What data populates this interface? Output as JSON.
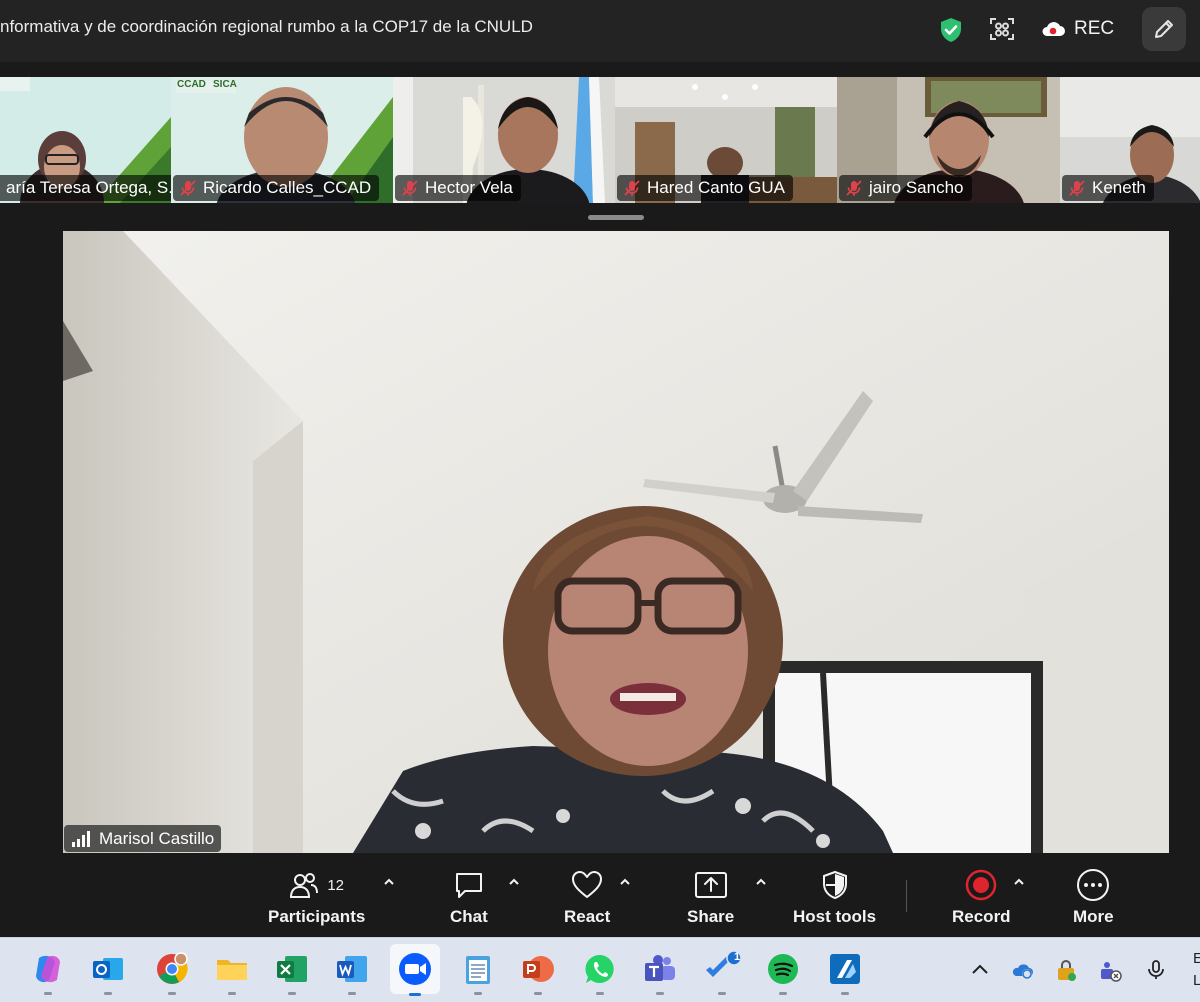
{
  "window": {
    "title": "nformativa y de coordinación regional rumbo a la COP17 de la CNULD",
    "rec_label": "REC"
  },
  "participants": [
    {
      "name": "aría Teresa Ortega, S..."
    },
    {
      "name": "Ricardo Calles_CCAD"
    },
    {
      "name": "Hector Vela"
    },
    {
      "name": "Hared Canto GUA"
    },
    {
      "name": "jairo Sancho"
    },
    {
      "name": "Keneth"
    }
  ],
  "tile_logos": {
    "ccad": "CCAD",
    "sica": "SICA"
  },
  "active_speaker": {
    "name": "Marisol Castillo"
  },
  "toolbar": {
    "participants_label": "Participants",
    "participants_count": "12",
    "chat_label": "Chat",
    "react_label": "React",
    "share_label": "Share",
    "host_tools_label": "Host tools",
    "record_label": "Record",
    "more_label": "More"
  },
  "taskbar": {
    "todo_badge": "1",
    "clipped_text": [
      "E",
      "L"
    ]
  },
  "colors": {
    "shield_green": "#2fbf71",
    "record_red": "#e0242e",
    "muted_red": "#e0414a",
    "zoom_blue": "#0b5cff"
  }
}
